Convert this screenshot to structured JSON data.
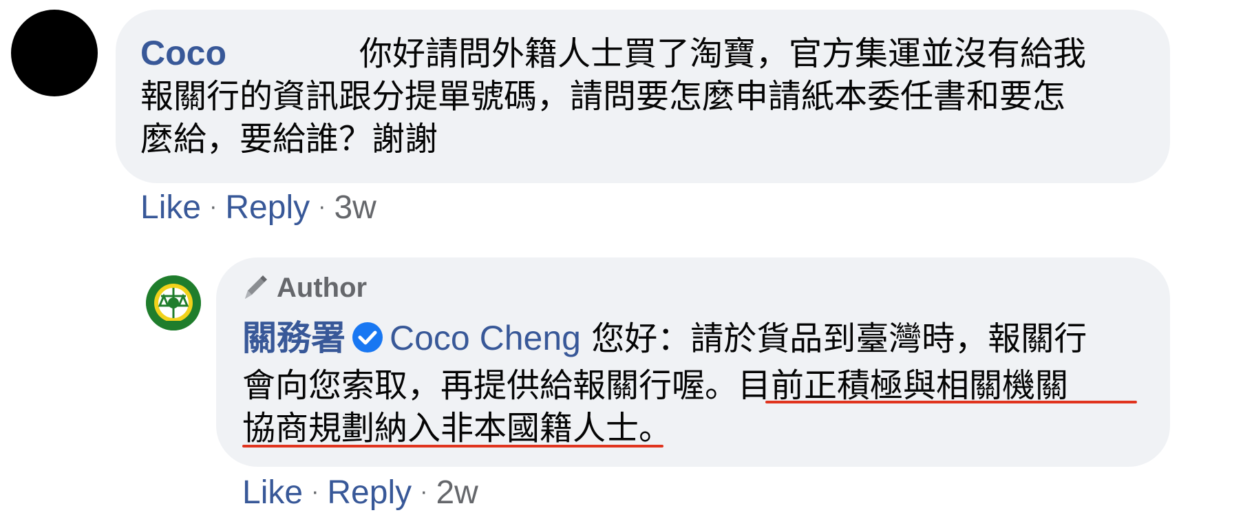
{
  "comment": {
    "author": "Coco",
    "lines": [
      "你好請問外籍人士買了淘寶，官方集運並沒有給我",
      "報關行的資訊跟分提單號碼，請問要怎麼申請紙本委任書和要怎",
      "麼給，要給誰？謝謝"
    ],
    "like_label": "Like",
    "reply_label": "Reply",
    "timestamp": "3w",
    "separator": "·"
  },
  "reply": {
    "badge_label": "Author",
    "author": "關務署",
    "mention": "Coco Cheng",
    "line1_text": "您好：請於貨品到臺灣時，報關行",
    "line2_text": "會向您索取，再提供給報關行喔。",
    "line2_highlight": "目前正積極與相關機關",
    "line3_highlight": "協商規劃納入非本國籍人士",
    "line3_text": "。",
    "like_label": "Like",
    "reply_label": "Reply",
    "timestamp": "2w",
    "separator": "·"
  },
  "icons": {
    "verified": "verified-badge-icon",
    "author_badge": "pen-icon",
    "customs_logo": "customs-logo"
  },
  "colors": {
    "link": "#385898",
    "bubble": "#f0f2f5",
    "underline": "#e0341e",
    "verified": "#1877f2",
    "meta": "#65676b"
  }
}
